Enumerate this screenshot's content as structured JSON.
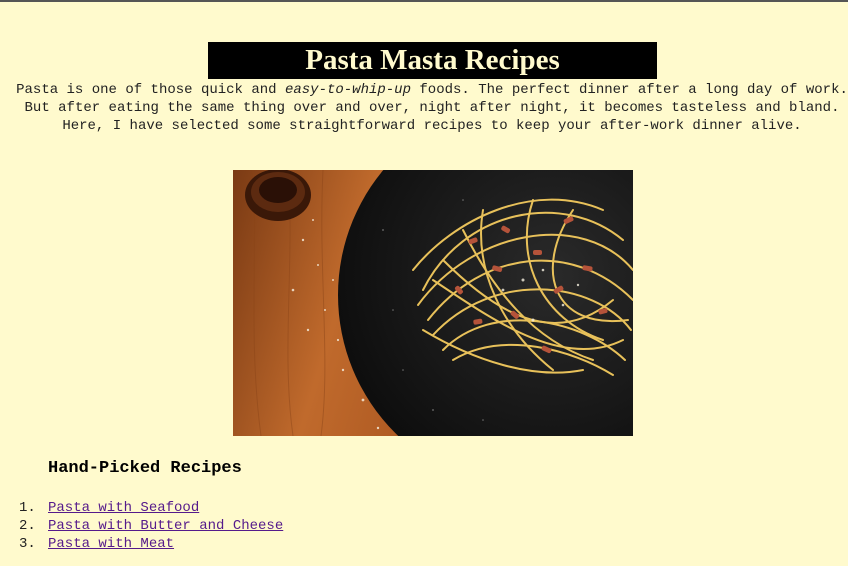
{
  "page": {
    "title": "Pasta Masta Recipes",
    "intro_before": "Pasta is one of those quick and ",
    "intro_emphasis": "easy-to-whip-up",
    "intro_after": " foods. The perfect dinner after a long day of work. But after eating the same thing over and over, night after night, it becomes tasteless and bland. Here, I have selected some straightforward recipes to keep your after-work dinner alive."
  },
  "hero_image": {
    "icon": "pasta-photo",
    "colors": {
      "wood": "#b5652a",
      "plate": "#141414",
      "pasta": "#e8c15a",
      "bacon": "#b5533a"
    }
  },
  "recipes": {
    "heading": "Hand-Picked Recipes",
    "items": [
      {
        "number": "1.",
        "label": "Pasta with Seafood"
      },
      {
        "number": "2.",
        "label": "Pasta with Butter and Cheese"
      },
      {
        "number": "3.",
        "label": "Pasta with Meat"
      }
    ]
  },
  "colors": {
    "background": "#fffacd",
    "title_bg": "#000000",
    "link": "#551a8b"
  }
}
